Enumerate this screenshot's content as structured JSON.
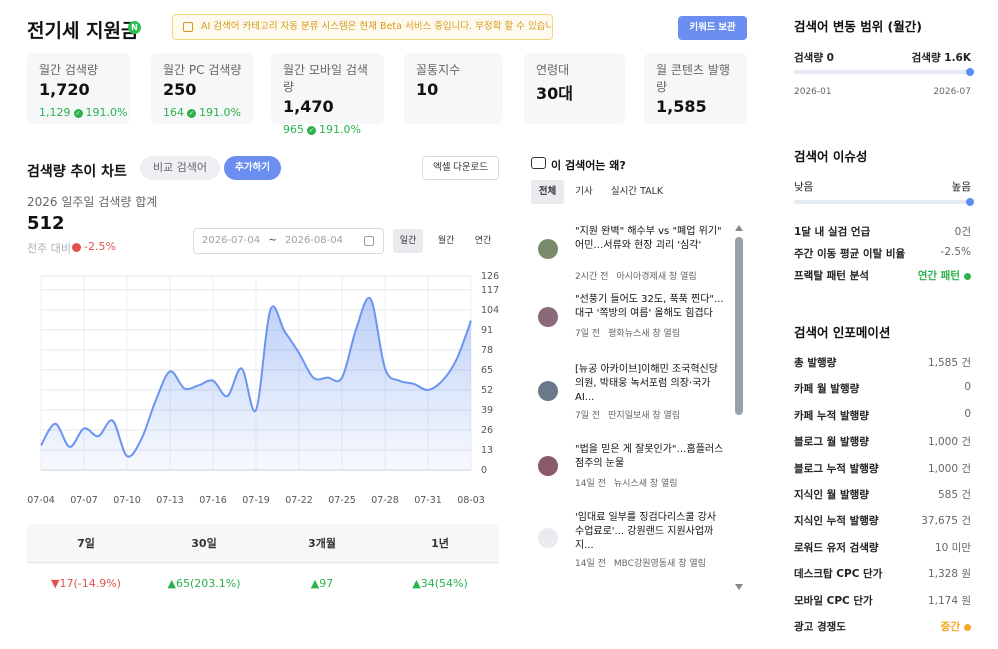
{
  "header": {
    "title": "전기세 지원금",
    "badge": "N",
    "beta_notice": "AI 검색어 카테고리 자동 분류 시스템은 현재 Beta 서비스 중입니다. 부정확 할 수 있습니다.",
    "keyword_save": "키워드 보관"
  },
  "stats": [
    {
      "label": "월간 검색량",
      "value": "1,720",
      "sub_value": "1,129",
      "sub_pct": "191.0%"
    },
    {
      "label": "월간 PC 검색량",
      "value": "250",
      "sub_value": "164",
      "sub_pct": "191.0%"
    },
    {
      "label": "월간 모바일 검색량",
      "value": "1,470",
      "sub_value": "965",
      "sub_pct": "191.0%"
    },
    {
      "label": "꼴통지수",
      "value": "10"
    },
    {
      "label": "연령대",
      "value": "30대"
    },
    {
      "label": "월 콘텐츠 발행량",
      "value": "1,585"
    }
  ],
  "trend": {
    "title": "검색량 추이 차트",
    "compare_keyword": "비교 검색어",
    "add": "추가하기",
    "excel": "엑셀 다운로드",
    "sum_label": "2026 일주일 검색량 합계",
    "sum_value": "512",
    "prev_label": "전주 대비",
    "prev_value": "-2.5%",
    "date_from": "2026-07-04",
    "date_sep": "~",
    "date_to": "2026-08-04",
    "periods": [
      "일간",
      "월간",
      "연간"
    ]
  },
  "chart_data": {
    "type": "area",
    "x": [
      "07-04",
      "07-05",
      "07-06",
      "07-07",
      "07-08",
      "07-09",
      "07-10",
      "07-11",
      "07-12",
      "07-13",
      "07-14",
      "07-15",
      "07-16",
      "07-17",
      "07-18",
      "07-19",
      "07-20",
      "07-21",
      "07-22",
      "07-23",
      "07-24",
      "07-25",
      "07-26",
      "07-27",
      "07-28",
      "07-29",
      "07-30",
      "07-31",
      "08-01",
      "08-02",
      "08-03"
    ],
    "x_ticks": [
      "07-04",
      "07-07",
      "07-10",
      "07-13",
      "07-16",
      "07-19",
      "07-22",
      "07-25",
      "07-28",
      "07-31",
      "08-03"
    ],
    "values": [
      16,
      30,
      15,
      27,
      22,
      32,
      9,
      20,
      45,
      64,
      53,
      55,
      58,
      48,
      66,
      39,
      104,
      90,
      76,
      60,
      60,
      60,
      92,
      111,
      66,
      58,
      56,
      52,
      58,
      72,
      97
    ],
    "ylim": [
      0,
      126
    ],
    "y_ticks": [
      0,
      13,
      26,
      39,
      52,
      65,
      78,
      91,
      104,
      117,
      126
    ],
    "y_tick_labels": [
      "0",
      "13",
      "26",
      "39",
      "52",
      "65",
      "78",
      "91",
      "104",
      "117",
      "126"
    ],
    "grid": true,
    "color": "#6b95f0"
  },
  "summary": {
    "headers": [
      "7일",
      "30일",
      "3개월",
      "1년"
    ],
    "values": [
      {
        "text": "▼17(-14.9%)",
        "dir": "down"
      },
      {
        "text": "▲65(203.1%)",
        "dir": "up"
      },
      {
        "text": "▲97",
        "dir": "up"
      },
      {
        "text": "▲34(54%)",
        "dir": "up"
      }
    ]
  },
  "news_panel": {
    "title": "이 검색어는 왜?",
    "tabs": [
      "전체",
      "기사",
      "실시간 TALK"
    ],
    "items": [
      {
        "title": "\"지원 완벽\" 해수부 vs \"폐업 위기\" 어민…서류와 현장 괴리 '심각'",
        "time": "2시간 전",
        "source": "아시아경제새 창 열림"
      },
      {
        "title": "\"선풍기 들어도 32도, 푹푹 찐다\"... 대구 '쪽방의 여름' 올해도 힘겹다",
        "time": "7일 전",
        "source": "평화뉴스새 창 열림"
      },
      {
        "title": "[뉴공 아카이브]이해민 조국혁신당 의원, 박태웅 녹서포럼 의장·국가AI...",
        "time": "7일 전",
        "source": "딴지일보새 창 열림"
      },
      {
        "title": "\"법을 믿은 게 잘못인가\"…홈플러스 점주의 눈물",
        "time": "14일 전",
        "source": "뉴시스새 창 열림"
      },
      {
        "title": "'임대료 일부를 징검다리스쿨 강사 수업료로'... 강원랜드 지원사업까지...",
        "time": "14일 전",
        "source": "MBC강원영동새 창 열림"
      }
    ]
  },
  "range": {
    "title": "검색어 변동 범위 (월간)",
    "min_label": "검색량 0",
    "max_label": "검색량 1.6K",
    "start": "2026-01",
    "end": "2026-07"
  },
  "issue": {
    "title": "검색어 이슈성",
    "low": "낮음",
    "high": "높음",
    "rows": [
      {
        "k": "1달 내 실검 언급",
        "v": "0건"
      },
      {
        "k": "주간 이동 평균 이탈 비율",
        "v": "-2.5%"
      },
      {
        "k": "프랙탈 패턴 분석",
        "v": "연간 패턴"
      }
    ]
  },
  "info": {
    "title": "검색어 인포메이션",
    "rows": [
      {
        "k": "총 발행량",
        "v": "1,585 건"
      },
      {
        "k": "카페 월 발행량",
        "v": "0"
      },
      {
        "k": "카페 누적 발행량",
        "v": "0"
      },
      {
        "k": "블로그 월 발행량",
        "v": "1,000 건"
      },
      {
        "k": "블로그 누적 발행량",
        "v": "1,000 건"
      },
      {
        "k": "지식인 월 발행량",
        "v": "585 건"
      },
      {
        "k": "지식인 누적 발행량",
        "v": "37,675 건"
      },
      {
        "k": "로워드 유저 검색량",
        "v": "10 미만"
      },
      {
        "k": "데스크탑 CPC 단가",
        "v": "1,328 원"
      },
      {
        "k": "모바일 CPC 단가",
        "v": "1,174 원"
      },
      {
        "k": "광고 경쟁도",
        "v": "중간"
      }
    ]
  }
}
